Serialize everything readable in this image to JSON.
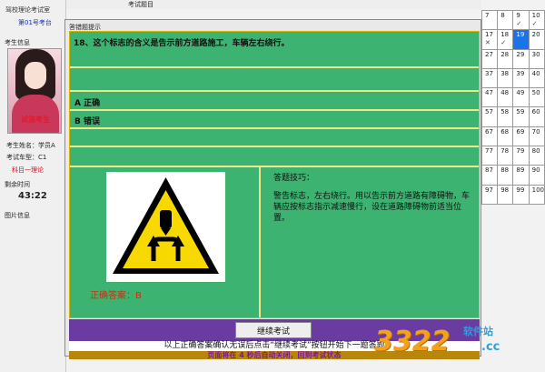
{
  "left_panel": {
    "title": "驾校理论考试室",
    "seat": "第01号考台",
    "candidate_section": "考生信息",
    "avatar_stamp": "试演考生",
    "name_line": "考生姓名：学员A",
    "car_type_line": "考试车型：C1",
    "subject": "科目一理论",
    "time_section": "剩余时间",
    "remaining_time": "43:22",
    "image_section": "图片信息"
  },
  "top_strip": {
    "label_top": "考试题目",
    "label_sub": ""
  },
  "modal": {
    "title": "答错题提示",
    "question": "18、这个标志的含义是告示前方道路施工，车辆左右绕行。",
    "options": [
      "A 正确",
      "B 错误"
    ],
    "correct_answer": "正确答案：B",
    "tips_title": "答题技巧：",
    "tips_body": "警告标志，左右绕行。用以告示前方道路有障碍物，车辆应按标志指示减速慢行，设在道路障碍物前适当位置。",
    "continue_button": "继续考试",
    "instruction": "以上正确答案确认无误后点击“继续考试”按钮开始下一题答题",
    "auto_close": "页面将在 4 秒后自动关闭，回到考试状态"
  },
  "answer_grid": {
    "cells": [
      {
        "n": "7",
        "mark": "",
        "hl": false
      },
      {
        "n": "8",
        "mark": "",
        "hl": false
      },
      {
        "n": "9",
        "mark": "✓",
        "hl": false
      },
      {
        "n": "10",
        "mark": "✓",
        "hl": false
      },
      {
        "n": "17",
        "mark": "✕",
        "hl": false
      },
      {
        "n": "18",
        "mark": "✓",
        "hl": false
      },
      {
        "n": "19",
        "mark": "",
        "hl": true
      },
      {
        "n": "20",
        "mark": "",
        "hl": false
      },
      {
        "n": "27",
        "mark": "",
        "hl": false
      },
      {
        "n": "28",
        "mark": "",
        "hl": false
      },
      {
        "n": "29",
        "mark": "",
        "hl": false
      },
      {
        "n": "30",
        "mark": "",
        "hl": false
      },
      {
        "n": "37",
        "mark": "",
        "hl": false
      },
      {
        "n": "38",
        "mark": "",
        "hl": false
      },
      {
        "n": "39",
        "mark": "",
        "hl": false
      },
      {
        "n": "40",
        "mark": "",
        "hl": false
      },
      {
        "n": "47",
        "mark": "",
        "hl": false
      },
      {
        "n": "48",
        "mark": "",
        "hl": false
      },
      {
        "n": "49",
        "mark": "",
        "hl": false
      },
      {
        "n": "50",
        "mark": "",
        "hl": false
      },
      {
        "n": "57",
        "mark": "",
        "hl": false
      },
      {
        "n": "58",
        "mark": "",
        "hl": false
      },
      {
        "n": "59",
        "mark": "",
        "hl": false
      },
      {
        "n": "60",
        "mark": "",
        "hl": false
      },
      {
        "n": "67",
        "mark": "",
        "hl": false
      },
      {
        "n": "68",
        "mark": "",
        "hl": false
      },
      {
        "n": "69",
        "mark": "",
        "hl": false
      },
      {
        "n": "70",
        "mark": "",
        "hl": false
      },
      {
        "n": "77",
        "mark": "",
        "hl": false
      },
      {
        "n": "78",
        "mark": "",
        "hl": false
      },
      {
        "n": "79",
        "mark": "",
        "hl": false
      },
      {
        "n": "80",
        "mark": "",
        "hl": false
      },
      {
        "n": "87",
        "mark": "",
        "hl": false
      },
      {
        "n": "88",
        "mark": "",
        "hl": false
      },
      {
        "n": "89",
        "mark": "",
        "hl": false
      },
      {
        "n": "90",
        "mark": "",
        "hl": false
      },
      {
        "n": "97",
        "mark": "",
        "hl": false
      },
      {
        "n": "98",
        "mark": "",
        "hl": false
      },
      {
        "n": "99",
        "mark": "",
        "hl": false
      },
      {
        "n": "100",
        "mark": "",
        "hl": false
      }
    ]
  },
  "watermark": {
    "number": "3322",
    "text": "软件站",
    "domain": ".cc"
  },
  "colors": {
    "content_green": "#3cb371",
    "divider_yellow": "#f0e68c",
    "button_bar_purple": "#6a3ba0",
    "highlight_blue": "#1a73e8",
    "answer_red": "#c83010"
  }
}
